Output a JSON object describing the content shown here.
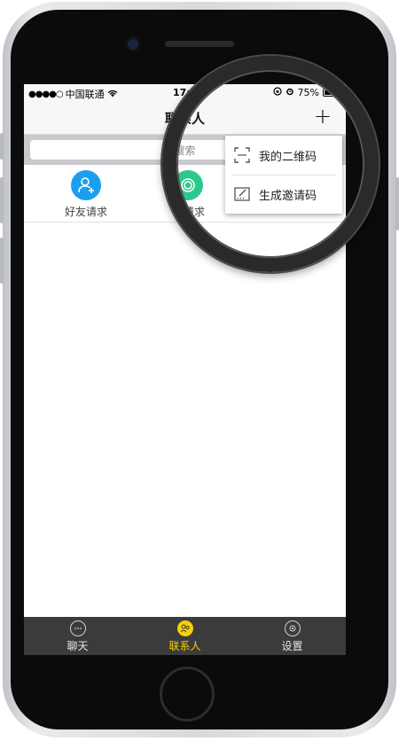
{
  "status_bar": {
    "carrier": "中国联通",
    "time": "17:",
    "battery": "75%",
    "battery_level": 0.75
  },
  "nav": {
    "title": "联系人",
    "add_label": "+"
  },
  "search": {
    "placeholder": "搜索"
  },
  "quick_actions": [
    {
      "label": "好友请求",
      "icon": "add-user-icon",
      "color": "#1a9ff0"
    },
    {
      "label": "请求",
      "icon": "group-icon",
      "color": "#2cc98c"
    }
  ],
  "menu": {
    "items": [
      {
        "label": "我的二维码",
        "icon": "qr-scan-icon"
      },
      {
        "label": "生成邀请码",
        "icon": "invite-code-icon"
      }
    ]
  },
  "tabs": [
    {
      "label": "聊天",
      "icon": "chat-icon",
      "active": false
    },
    {
      "label": "联系人",
      "icon": "contacts-icon",
      "active": true
    },
    {
      "label": "设置",
      "icon": "settings-icon",
      "active": false
    }
  ],
  "colors": {
    "accent": "#f5d10a",
    "tab_bg": "#3b3b3b",
    "friend_request": "#1a9ff0",
    "group_request": "#2cc98c"
  }
}
